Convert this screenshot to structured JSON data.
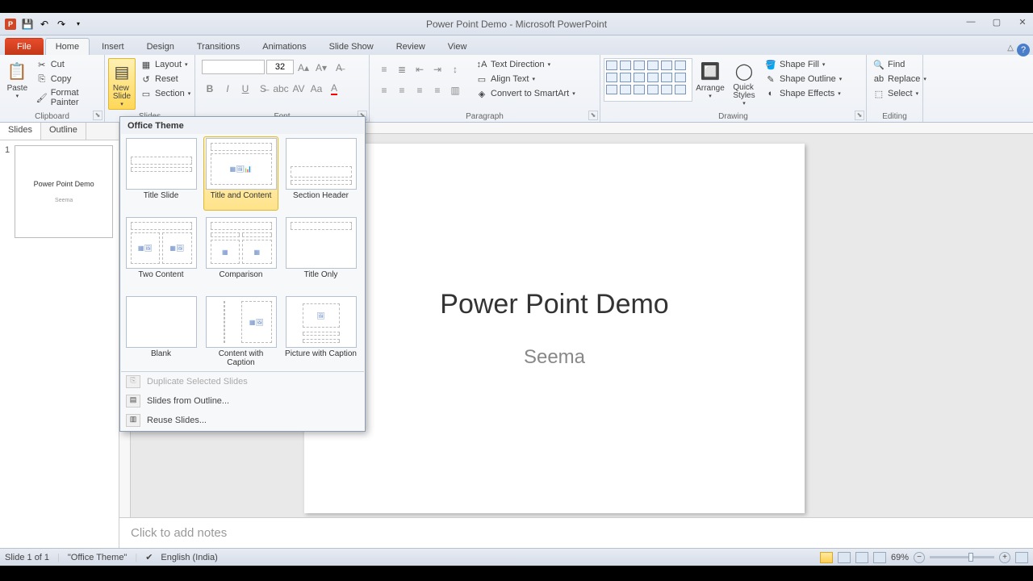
{
  "titlebar": {
    "title": "Power Point Demo  -  Microsoft PowerPoint"
  },
  "tabs": {
    "file": "File",
    "home": "Home",
    "insert": "Insert",
    "design": "Design",
    "transitions": "Transitions",
    "animations": "Animations",
    "slideshow": "Slide Show",
    "review": "Review",
    "view": "View"
  },
  "ribbon": {
    "clipboard": {
      "label": "Clipboard",
      "paste": "Paste",
      "cut": "Cut",
      "copy": "Copy",
      "format_painter": "Format Painter"
    },
    "slides": {
      "label": "Slides",
      "new_slide": "New\nSlide",
      "layout": "Layout",
      "reset": "Reset",
      "section": "Section"
    },
    "font": {
      "label": "Font",
      "size": "32"
    },
    "paragraph": {
      "label": "Paragraph",
      "text_direction": "Text Direction",
      "align_text": "Align Text",
      "smartart": "Convert to SmartArt"
    },
    "drawing": {
      "label": "Drawing",
      "arrange": "Arrange",
      "quick_styles": "Quick\nStyles",
      "shape_fill": "Shape Fill",
      "shape_outline": "Shape Outline",
      "shape_effects": "Shape Effects"
    },
    "editing": {
      "label": "Editing",
      "find": "Find",
      "replace": "Replace",
      "select": "Select"
    }
  },
  "side_panel": {
    "slides_tab": "Slides",
    "outline_tab": "Outline",
    "thumb1_num": "1",
    "thumb1_title": "Power Point Demo",
    "thumb1_sub": "Seema"
  },
  "slide": {
    "title": "Power Point Demo",
    "subtitle": "Seema"
  },
  "notes": {
    "placeholder": "Click to add notes"
  },
  "layout_gallery": {
    "header": "Office Theme",
    "layouts": {
      "title_slide": "Title Slide",
      "title_content": "Title and Content",
      "section_header": "Section Header",
      "two_content": "Two Content",
      "comparison": "Comparison",
      "title_only": "Title Only",
      "blank": "Blank",
      "content_caption": "Content with Caption",
      "picture_caption": "Picture with Caption"
    },
    "duplicate": "Duplicate Selected Slides",
    "from_outline": "Slides from Outline...",
    "reuse": "Reuse Slides..."
  },
  "statusbar": {
    "slide_info": "Slide 1 of 1",
    "theme": "\"Office Theme\"",
    "language": "English (India)",
    "zoom": "69%"
  }
}
